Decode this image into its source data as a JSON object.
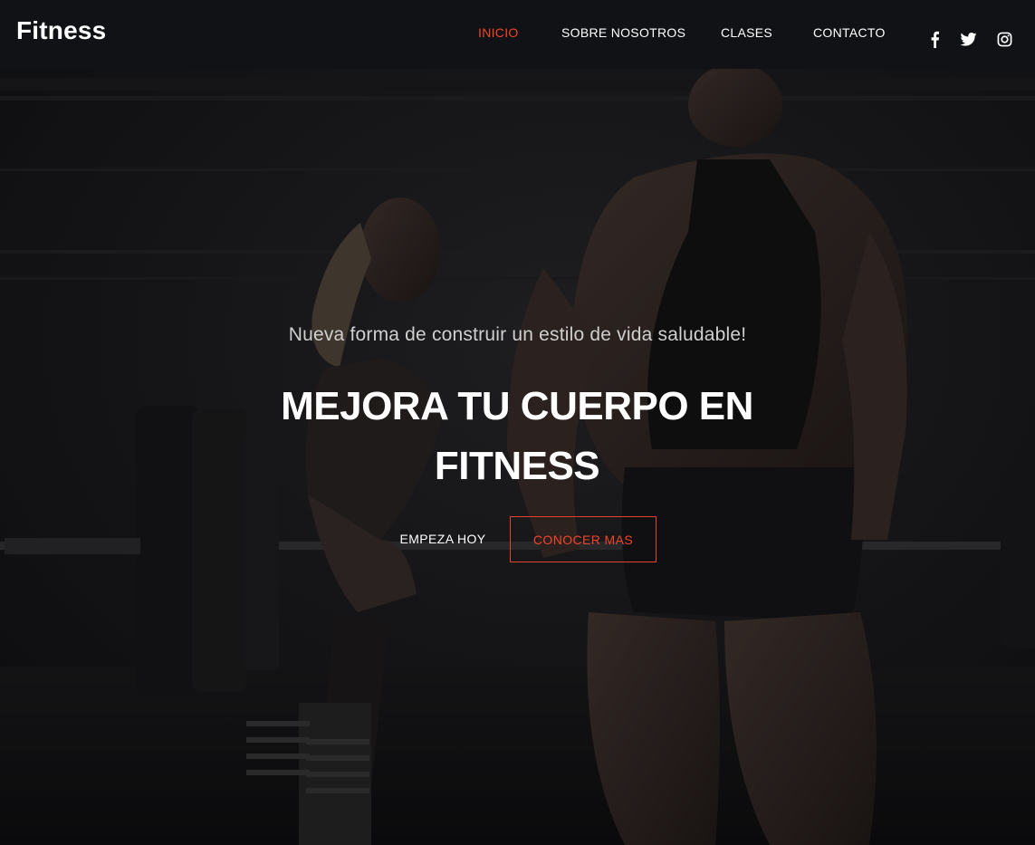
{
  "brand": {
    "name": "Fitness"
  },
  "nav": {
    "items": [
      {
        "label": "INICIO",
        "active": true
      },
      {
        "label": "SOBRE NOSOTROS",
        "active": false
      },
      {
        "label": "CLASES",
        "active": false
      },
      {
        "label": "CONTACTO",
        "active": false
      }
    ]
  },
  "social": {
    "icons": [
      "facebook-icon",
      "twitter-icon",
      "instagram-icon"
    ]
  },
  "hero": {
    "tagline": "Nueva forma de construir un estilo de vida saludable!",
    "headline_line1": "MEJORA TU CUERPO EN",
    "headline_line2": "FITNESS",
    "primary_button": "EMPEZA HOY",
    "secondary_button": "CONOCER MAS",
    "background": "gym-deadlift-photo"
  },
  "colors": {
    "accent": "#f2452a",
    "header_bg": "#111215",
    "text": "#ffffff"
  }
}
